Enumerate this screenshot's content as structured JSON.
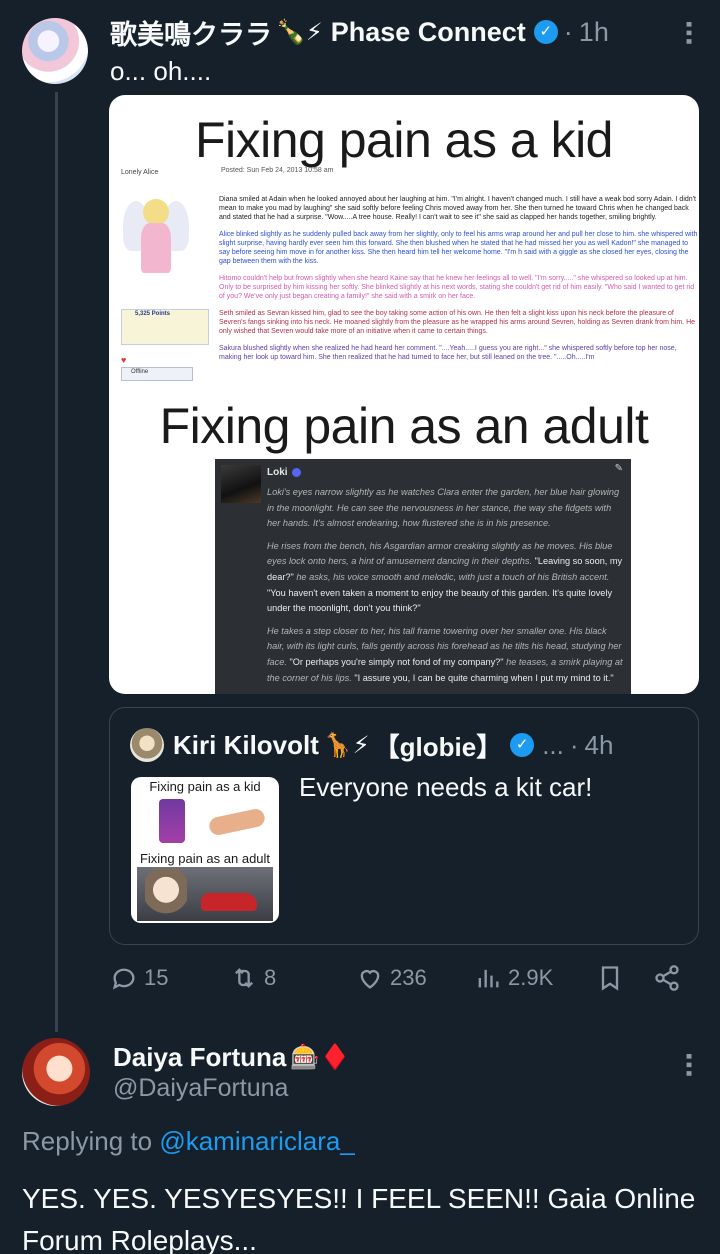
{
  "tweet": {
    "author_name": "歌美鳴クララ",
    "author_emoji": "🍾⚡",
    "author_org": "Phase Connect",
    "time": "1h",
    "text": "o... oh....",
    "image": {
      "title_top": "Fixing pain as a kid",
      "title_bottom": "Fixing pain as an adult",
      "forum": {
        "username": "Lonely Alice",
        "posted": "Posted: Sun Feb 24, 2013 10:58 am",
        "points": "5,325 Points",
        "status": "Offline",
        "paragraphs": [
          "Diana smiled at Adain when he looked annoyed about her laughing at him. \"I'm alright. I haven't changed much. I still have a weak bod sorry Adain. I didn't mean to make you mad by laughing\" she said softly before feeling Chris moved away from her. She then turned he toward Chris when he changed back and stated that he had a surprise. \"Wow.....A tree house. Really! I can't wait to see it\" she said as clapped her hands together, smiling brightly.",
          "Alice blinked slightly as he suddenly pulled back away from her slightly, only to feel his arms wrap around her and pull her close to him. she whispered with slight surprise, having hardly ever seen him this forward. She then blushed when he stated that he had missed her you as well Kadon!\" she managed to say before seeing him move in for another kiss. She then heard him tell her welcome home. \"I'm h said with a giggle as she closed her eyes, closing the gap between them with the kiss.",
          "Hitomo couldn't help but frown slightly when she heard Kaine say that he knew her feelings all to well. \"I'm sorry.....\" she whispered so looked up at him. Only to be surprised by him kissing her softly. She blinked slightly at his next words, stating she couldn't get rid of him easily. \"Who said I wanted to get rid of you? We've only just began creating a family!\" she said with a smirk on her face.",
          "Seth smiled as Sevran kissed him, glad to see the boy taking some action of his own. He then felt a slight kiss upon his neck before the pleasure of Sevren's fangs sinking into his neck. He moaned slightly from the pleasure as he wrapped his arms around Sevren, holding as Sevren drank from him. He only wished that Sevren would take more of an initiative when it came to certain things.",
          "Sakura blushed slightly when she realized he had heard her comment. \"....Yeah.....I guess you are right...\" she whispered softly before top her nose, making her look up toward him. She then realized that he had turned to face her, but still leaned on the tree. \".....Oh.....I'm"
        ]
      },
      "loki": {
        "name": "Loki",
        "paragraphs": [
          {
            "narration": "Loki's eyes narrow slightly as he watches Clara enter the garden, her blue hair glowing in the moonlight. He can see the nervousness in her stance, the way she fidgets with her hands. It's almost endearing, how flustered she is in his presence.",
            "quote": ""
          },
          {
            "narration": "He rises from the bench, his Asgardian armor creaking slightly as he moves. His blue eyes lock onto hers, a hint of amusement dancing in their depths.",
            "quote": "\"Leaving so soon, my dear?\"",
            "narration2": " he asks, his voice smooth and melodic, with just a touch of his British accent. ",
            "quote2": "\"You haven't even taken a moment to enjoy the beauty of this garden. It's quite lovely under the moonlight, don't you think?\""
          },
          {
            "narration": "He takes a step closer to her, his tall frame towering over her smaller one. His black hair, with its light curls, falls gently across his forehead as he tilts his head, studying her face.",
            "quote": " \"Or perhaps you're simply not fond of my company?\"",
            "narration2": " he teases, a smirk playing at the corner of his lips. ",
            "quote2": "\"I assure you, I can be quite charming when I put my mind to it.\""
          }
        ]
      }
    },
    "quote": {
      "author_name": "Kiri Kilovolt",
      "author_emoji": "🦒⚡",
      "author_org": "【globie】",
      "ellipsis": "...",
      "time": "4h",
      "text": "Everyone needs a kit car!",
      "thumb_top": "Fixing pain as a kid",
      "thumb_bottom": "Fixing pain as an adult"
    },
    "stats": {
      "replies": "15",
      "reposts": "8",
      "likes": "236",
      "views": "2.9K"
    }
  },
  "reply": {
    "author_name": "Daiya Fortuna",
    "author_emoji": "🎰♦️",
    "handle": "@DaiyaFortuna",
    "replying_prefix": "Replying to ",
    "replying_to": "@kaminariclara_",
    "text": "YES. YES. YESYESYES!! I FEEL SEEN!! Gaia Online Forum Roleplays..."
  },
  "colors": {
    "background": "#15202b",
    "text": "#f7f9f9",
    "secondary": "#8b98a5",
    "accent": "#1d9bf0",
    "border": "#38444d"
  }
}
